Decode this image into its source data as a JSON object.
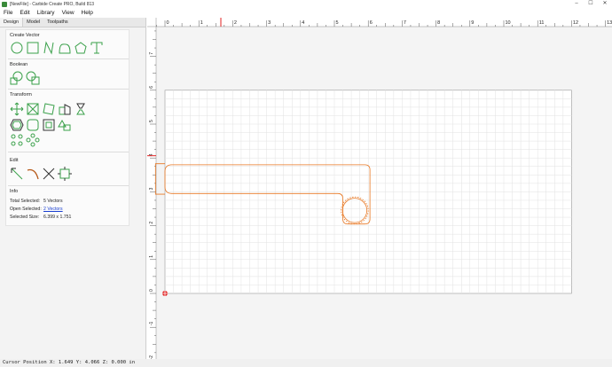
{
  "window": {
    "title": "[NewFile] - Carbide Create PRO, Build 813",
    "minimize": "–",
    "maximize": "☐",
    "close": "✕"
  },
  "menu": {
    "items": [
      {
        "label": "File"
      },
      {
        "label": "Edit"
      },
      {
        "label": "Library"
      },
      {
        "label": "View"
      },
      {
        "label": "Help"
      }
    ]
  },
  "tabs": [
    {
      "label": "Design",
      "active": true
    },
    {
      "label": "Model",
      "active": false
    },
    {
      "label": "Toolpaths",
      "active": false
    }
  ],
  "sections": {
    "create_vector": "Create Vector",
    "boolean": "Boolean",
    "transform": "Transform",
    "edit": "Edit",
    "info": "Info"
  },
  "tool_icons": {
    "create_vector": [
      "circle-icon",
      "rectangle-icon",
      "polyline-icon",
      "curve-icon",
      "polygon-icon",
      "text-icon"
    ],
    "boolean": [
      "union-icon",
      "subtract-icon"
    ],
    "transform": [
      "move-icon",
      "scale-icon",
      "rotate-icon",
      "align-icon",
      "mirror-icon",
      "offset-icon",
      "fillet-icon",
      "inset-icon",
      "array-icon",
      "pattern-icon",
      "circular-array-icon"
    ],
    "edit": [
      "node-edit-icon",
      "bezier-edit-icon",
      "trim-icon",
      "join-icon"
    ]
  },
  "info": {
    "total_selected_label": "Total Selected:",
    "total_selected_value": "5 Vectors",
    "open_selected_label": "Open Selected:",
    "open_selected_value": "2 Vectors",
    "selected_size_label": "Selected Size:",
    "selected_size_value": "6.399 x 1.751"
  },
  "ruler": {
    "x_labels": [
      "0",
      "1",
      "2",
      "3",
      "4",
      "5",
      "6",
      "7",
      "8",
      "9",
      "10",
      "11",
      "12",
      "13"
    ],
    "y_labels": [
      "7",
      "6",
      "5",
      "4",
      "3",
      "2",
      "1",
      "0",
      "-1",
      "-2"
    ],
    "cursor_x": 1.649,
    "cursor_y": 4.066
  },
  "colors": {
    "vector": "#e87722",
    "grid": "#e2e2e2",
    "cursor_marker": "#e02020",
    "tool_green": "#3aa04a"
  },
  "status": {
    "text": "Cursor Position X: 1.649 Y: 4.066 Z: 0.000 in"
  }
}
